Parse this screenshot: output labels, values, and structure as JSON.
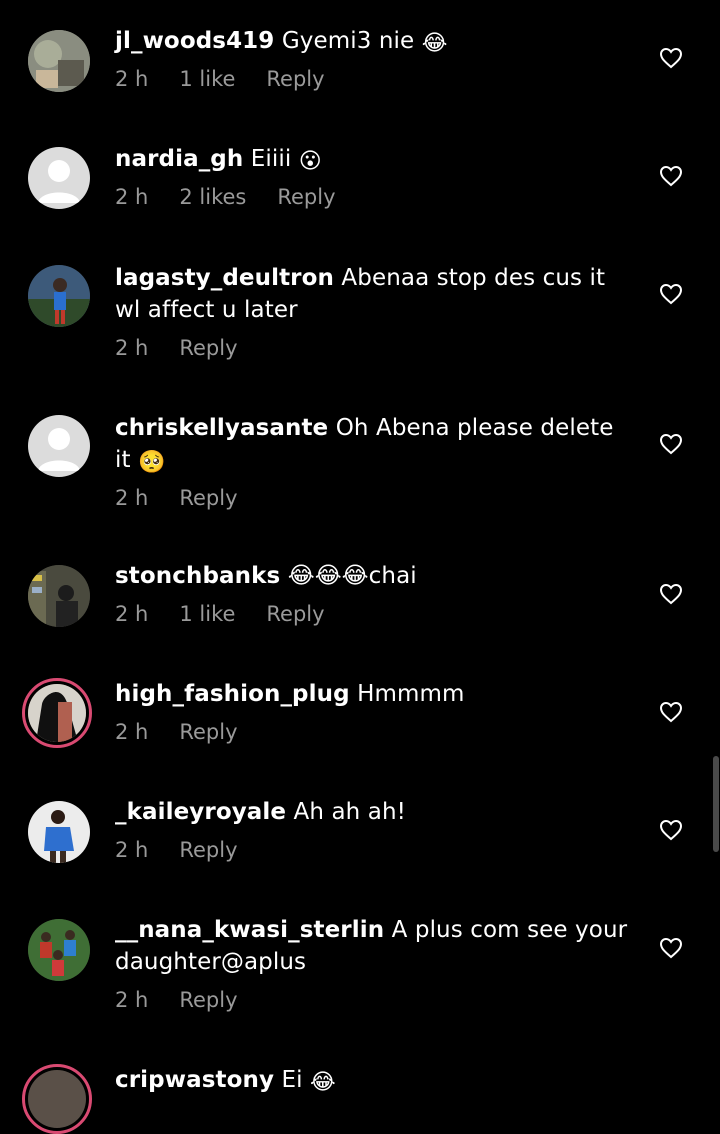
{
  "comments": [
    {
      "username": "jl_woods419",
      "text": "Gyemi3 nie",
      "emoji": "😂",
      "time": "2 h",
      "likes": "1 like",
      "reply": "Reply"
    },
    {
      "username": "nardia_gh",
      "text": "Eiiii",
      "emoji": "😮",
      "time": "2 h",
      "likes": "2 likes",
      "reply": "Reply"
    },
    {
      "username": "lagasty_deultron",
      "text": "Abenaa stop des cus it wl affect u later",
      "time": "2 h",
      "likes": "",
      "reply": "Reply"
    },
    {
      "username": "chriskellyasante",
      "text": "Oh Abena please delete it",
      "emoji": "🥺",
      "time": "2 h",
      "likes": "",
      "reply": "Reply"
    },
    {
      "username": "stonchbanks",
      "text": "😂😂😂chai",
      "time": "2 h",
      "likes": "1 like",
      "reply": "Reply"
    },
    {
      "username": "high_fashion_plug",
      "text": "Hmmmm",
      "time": "2 h",
      "likes": "",
      "reply": "Reply"
    },
    {
      "username": "_kaileyroyale",
      "text": "Ah ah ah!",
      "time": "2 h",
      "likes": "",
      "reply": "Reply"
    },
    {
      "username": "__nana_kwasi_sterlin",
      "text": "A plus com see your daughter@aplus",
      "time": "2 h",
      "likes": "",
      "reply": "Reply"
    },
    {
      "username": "cripwastony",
      "text": "Ei",
      "emoji": "😂",
      "time": "",
      "likes": "",
      "reply": ""
    }
  ],
  "colors": {
    "background": "#000000",
    "text": "#ffffff",
    "meta": "#9a9a9a",
    "story_ring": "#d94a72"
  },
  "icons": {
    "like": "heart-outline-icon",
    "default_avatar": "default-avatar-icon"
  }
}
